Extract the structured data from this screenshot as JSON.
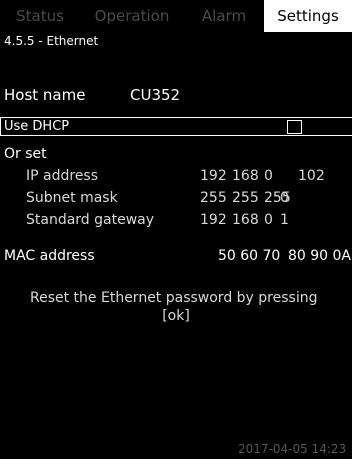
{
  "tabs": [
    {
      "label": "Status",
      "active": false
    },
    {
      "label": "Operation",
      "active": false
    },
    {
      "label": "Alarm",
      "active": false
    },
    {
      "label": "Settings",
      "active": true
    }
  ],
  "breadcrumb": "4.5.5 - Ethernet",
  "host": {
    "label": "Host name",
    "value": "CU352"
  },
  "dhcp": {
    "label": "Use DHCP",
    "checked": false
  },
  "or_set": {
    "label": "Or set",
    "ip_address": {
      "label": "IP address",
      "octets": [
        "192",
        "168",
        "0",
        "102"
      ]
    },
    "subnet_mask": {
      "label": "Subnet mask",
      "octets": [
        "255",
        "255",
        "255",
        "0"
      ]
    },
    "gateway": {
      "label": "Standard gateway",
      "octets": [
        "192",
        "168",
        "0",
        "1"
      ]
    }
  },
  "mac": {
    "label": "MAC address",
    "part1": "50 60 70",
    "part2": "80 90 0A"
  },
  "reset": {
    "line1": "Reset the Ethernet password by pressing",
    "line2": "[ok]"
  },
  "timestamp": "2017-04-05 14:23",
  "colors": {
    "background": "#000000",
    "foreground": "#ffffff",
    "active_tab_bg": "#ffffff",
    "inactive_tab_text": "#4a4a4a"
  }
}
